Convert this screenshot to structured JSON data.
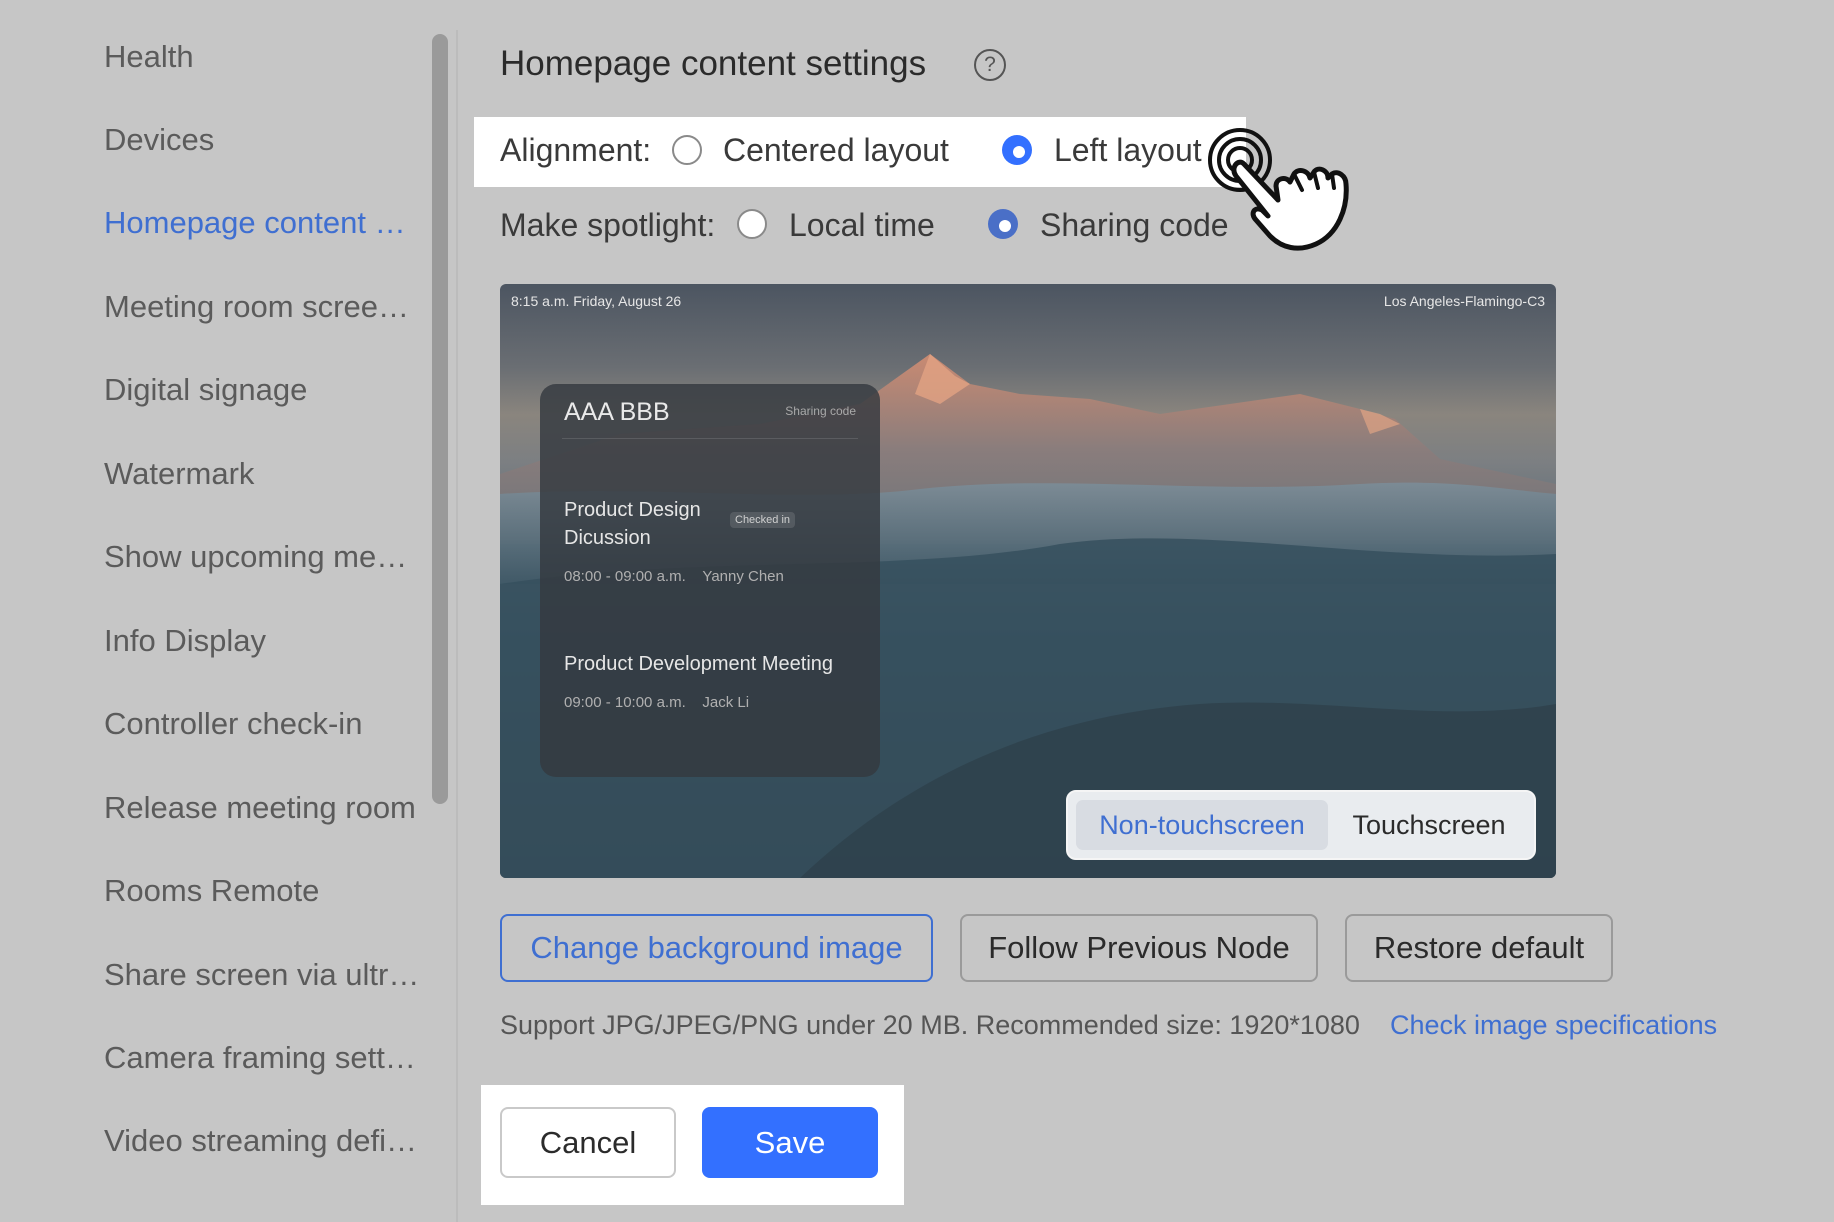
{
  "sidebar": {
    "items": [
      {
        "label": "Health",
        "active": false
      },
      {
        "label": "Devices",
        "active": false
      },
      {
        "label": "Homepage content settings",
        "active": true
      },
      {
        "label": "Meeting room screensaver",
        "active": false
      },
      {
        "label": "Digital signage",
        "active": false
      },
      {
        "label": "Watermark",
        "active": false
      },
      {
        "label": "Show upcoming meetings",
        "active": false
      },
      {
        "label": "Info Display",
        "active": false
      },
      {
        "label": "Controller check-in",
        "active": false
      },
      {
        "label": "Release meeting room",
        "active": false
      },
      {
        "label": "Rooms Remote",
        "active": false
      },
      {
        "label": "Share screen via ultrasound",
        "active": false
      },
      {
        "label": "Camera framing settings",
        "active": false
      },
      {
        "label": "Video streaming definition",
        "active": false
      }
    ]
  },
  "main": {
    "title": "Homepage content settings",
    "help_icon": "?",
    "alignment": {
      "label": "Alignment:",
      "options": [
        {
          "label": "Centered layout",
          "checked": false
        },
        {
          "label": "Left layout",
          "checked": true
        }
      ]
    },
    "spotlight": {
      "label": "Make spotlight:",
      "options": [
        {
          "label": "Local time",
          "checked": false
        },
        {
          "label": "Sharing code",
          "checked": true
        }
      ]
    },
    "preview": {
      "time": "8:15 a.m.  Friday, August 26",
      "location": "Los Angeles-Flamingo-C3",
      "card": {
        "room": "AAA BBB",
        "sharing_code_label": "Sharing code",
        "meetings": [
          {
            "title": "Product Design Dicussion",
            "badge": "Checked in",
            "time": "08:00 - 09:00 a.m.",
            "organizer": "Yanny Chen"
          },
          {
            "title": "Product Development Meeting",
            "badge": "",
            "time": "09:00 - 10:00 a.m.",
            "organizer": "Jack Li"
          }
        ]
      },
      "mode_tabs": {
        "active": "Non-touchscreen",
        "inactive": "Touchscreen"
      }
    },
    "buttons": {
      "change_bg": "Change background image",
      "follow_previous": "Follow Previous Node",
      "restore": "Restore default"
    },
    "hint": "Support JPG/JPEG/PNG under 20 MB. Recommended size: 1920*1080",
    "hint_link": "Check image specifications",
    "footer": {
      "cancel": "Cancel",
      "save": "Save"
    }
  },
  "colors": {
    "accent": "#3370ff",
    "link": "#3f6fd1",
    "overlay": "#c6c6c6"
  }
}
